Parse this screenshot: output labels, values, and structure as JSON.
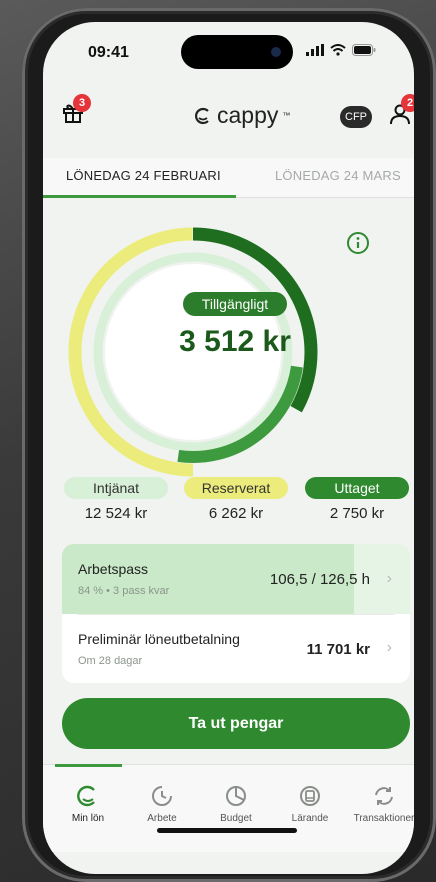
{
  "status_bar": {
    "time": "09:41"
  },
  "header": {
    "gift_badge": "3",
    "logo_text": "cappy",
    "cfp_label": "CFP",
    "profile_badge": "2"
  },
  "tabs": [
    {
      "label": "LÖNEDAG 24 FEBRUARI",
      "active": true
    },
    {
      "label": "LÖNEDAG 24 MARS",
      "active": false
    }
  ],
  "gauge": {
    "label": "Tillgängligt",
    "amount": "3 512 kr"
  },
  "legend": [
    {
      "label": "Intjänat",
      "value": "12 524 kr",
      "color": "#d8efd8",
      "text_color": "#333333"
    },
    {
      "label": "Reserverat",
      "value": "6 262 kr",
      "color": "#ecec7c",
      "text_color": "#333333"
    },
    {
      "label": "Uttaget",
      "value": "2 750 kr",
      "color": "#2f8a2f",
      "text_color": "#ffffff"
    }
  ],
  "work_shifts": {
    "title": "Arbetspass",
    "subtitle": "84 % • 3 pass kvar",
    "value": "106,5 / 126,5 h",
    "progress_fraction": 0.84
  },
  "preliminary_pay": {
    "title": "Preliminär löneutbetalning",
    "subtitle": "Om 28 dagar",
    "value": "11 701 kr"
  },
  "cta": {
    "label": "Ta ut pengar"
  },
  "tabbar": [
    {
      "label": "Min lön",
      "icon": "cappy-icon",
      "active": true
    },
    {
      "label": "Arbete",
      "icon": "clock-icon",
      "active": false
    },
    {
      "label": "Budget",
      "icon": "pie-chart-icon",
      "active": false
    },
    {
      "label": "Lärande",
      "icon": "book-icon",
      "active": false
    },
    {
      "label": "Transaktioner",
      "icon": "refresh-icon",
      "active": false
    }
  ],
  "colors": {
    "brand_green": "#2f8a2f",
    "dark_green": "#1f6e1f",
    "yellow": "#ecec7c",
    "light_green": "#d8efd8"
  }
}
